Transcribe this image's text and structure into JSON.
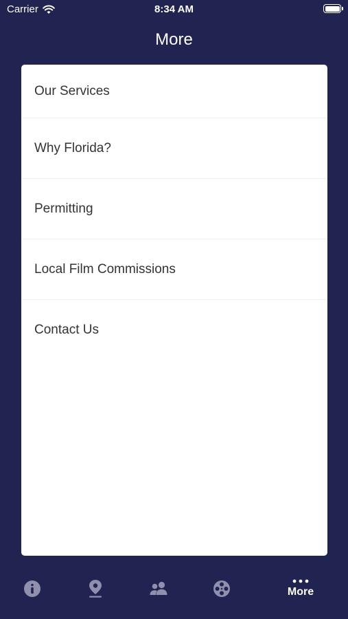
{
  "status_bar": {
    "carrier": "Carrier",
    "time": "8:34 AM"
  },
  "navigation": {
    "title": "More"
  },
  "menu": {
    "items": [
      {
        "label": "Our Services"
      },
      {
        "label": "Why Florida?"
      },
      {
        "label": "Permitting"
      },
      {
        "label": "Local Film Commissions"
      },
      {
        "label": "Contact Us"
      }
    ]
  },
  "tab_bar": {
    "tabs": [
      {
        "icon": "info-icon"
      },
      {
        "icon": "location-pin-icon"
      },
      {
        "icon": "people-icon"
      },
      {
        "icon": "film-reel-icon"
      },
      {
        "icon": "ellipsis-icon",
        "label": "More",
        "selected": true
      }
    ]
  },
  "colors": {
    "background": "#212351",
    "card": "#ffffff",
    "tab_inactive": "#8f90ad",
    "tab_active": "#ffffff"
  }
}
